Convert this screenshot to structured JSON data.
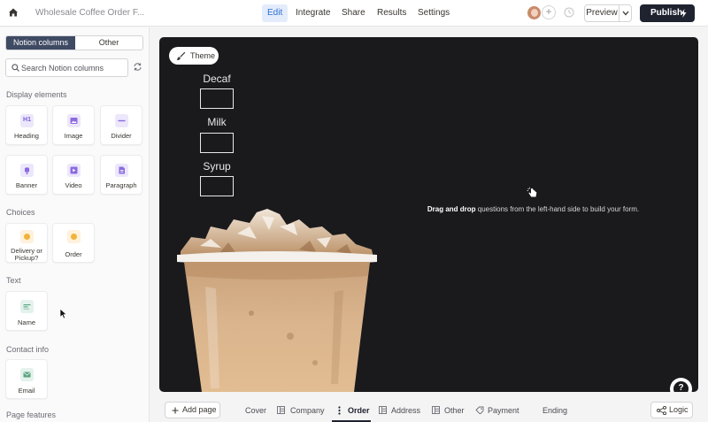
{
  "header": {
    "doc_title": "Wholesale Coffee Order F...",
    "nav": [
      "Edit",
      "Integrate",
      "Share",
      "Results",
      "Settings"
    ],
    "active_nav": "Edit",
    "plus": "+",
    "preview_label": "Preview",
    "publish_label": "Publish"
  },
  "sidebar": {
    "tabs": [
      "Notion columns",
      "Other"
    ],
    "search_placeholder": "Search Notion columns",
    "sections": {
      "display": "Display elements",
      "choices": "Choices",
      "text": "Text",
      "contact": "Contact info",
      "page": "Page features"
    },
    "display_items": [
      "Heading",
      "Image",
      "Divider",
      "Banner",
      "Video",
      "Paragraph"
    ],
    "choice_items": [
      "Delivery or Pickup?",
      "Order"
    ],
    "text_items": [
      "Name"
    ],
    "contact_items": [
      "Email"
    ],
    "heading_icon_text": "H1"
  },
  "canvas": {
    "theme_label": "Theme",
    "fields": [
      "Decaf",
      "Milk",
      "Syrup"
    ],
    "drag_bold": "Drag and drop",
    "drag_rest": " questions from the left-hand side to build your form.",
    "help_glyph": "?"
  },
  "footer": {
    "add_page": "Add page",
    "pages": [
      "Cover",
      "Company",
      "Order",
      "Address",
      "Other",
      "Payment",
      "Ending"
    ],
    "active_page": "Order",
    "logic_label": "Logic"
  },
  "colors": {
    "accent": "#2f6fd0",
    "publish_bg": "#1f2330",
    "canvas_bg": "#1a1a1d",
    "segment_active": "#3f4a63"
  }
}
